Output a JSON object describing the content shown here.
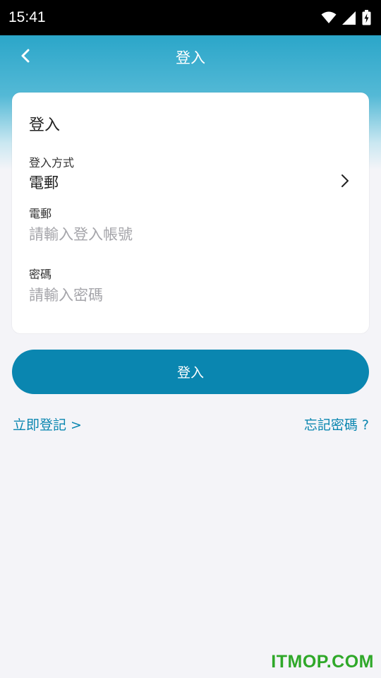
{
  "status_bar": {
    "time": "15:41",
    "icons": [
      "wifi-icon",
      "signal-icon",
      "battery-charging-icon"
    ]
  },
  "nav": {
    "title": "登入",
    "back_icon": "chevron-left-icon"
  },
  "card": {
    "title": "登入",
    "method_label": "登入方式",
    "method_value": "電郵",
    "email_label": "電郵",
    "email_placeholder": "請輸入登入帳號",
    "email_value": "",
    "password_label": "密碼",
    "password_placeholder": "請輸入密碼",
    "password_value": ""
  },
  "actions": {
    "login_label": "登入",
    "register_label": "立即登記 >",
    "forgot_label": "忘記密碼 ?"
  },
  "watermark": "ITMOP.COM",
  "colors": {
    "accent": "#0a86b0",
    "header_gradient_top": "#2ba6c9",
    "background": "#f4f4f8",
    "watermark": "#2fa829"
  }
}
